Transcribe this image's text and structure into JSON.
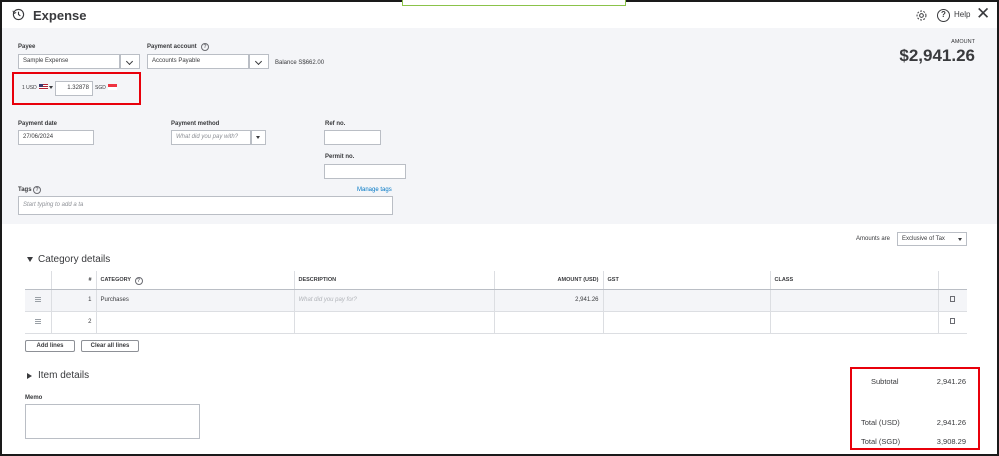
{
  "header": {
    "title": "Expense",
    "help_label": "Help",
    "close_glyph": "✕"
  },
  "payee": {
    "label": "Payee",
    "value": "Sample Expense"
  },
  "payment_account": {
    "label": "Payment account",
    "value": "Accounts Payable",
    "balance_text": "Balance S$662.00"
  },
  "exchange": {
    "from_currency": "1 USD",
    "rate": "1.32878",
    "to_currency": "SGD"
  },
  "amount": {
    "label": "AMOUNT",
    "value": "$2,941.26"
  },
  "payment_date": {
    "label": "Payment date",
    "value": "27/06/2024"
  },
  "payment_method": {
    "label": "Payment method",
    "placeholder": "What did you pay with?"
  },
  "ref_no": {
    "label": "Ref no.",
    "value": ""
  },
  "permit_no": {
    "label": "Permit no.",
    "value": ""
  },
  "tags": {
    "label": "Tags",
    "manage_link": "Manage tags",
    "placeholder": "Start typing to add a ta"
  },
  "amounts_are": {
    "label": "Amounts are",
    "value": "Exclusive of Tax"
  },
  "category_details": {
    "heading": "Category details",
    "columns": [
      "#",
      "CATEGORY",
      "DESCRIPTION",
      "AMOUNT (USD)",
      "GST",
      "CLASS"
    ],
    "rows": [
      {
        "num": "1",
        "category": "Purchases",
        "description": "What did you pay for?",
        "amount": "2,941.26",
        "gst": "",
        "class": ""
      },
      {
        "num": "2",
        "category": "",
        "description": "",
        "amount": "",
        "gst": "",
        "class": ""
      }
    ],
    "add_lines": "Add lines",
    "clear_all_lines": "Clear all lines"
  },
  "item_details": {
    "heading": "Item details"
  },
  "memo": {
    "label": "Memo",
    "value": ""
  },
  "totals": {
    "subtotal_label": "Subtotal",
    "subtotal_value": "2,941.26",
    "total_usd_label": "Total (USD)",
    "total_usd_value": "2,941.26",
    "total_sgd_label": "Total (SGD)",
    "total_sgd_value": "3,908.29"
  },
  "colors": {
    "highlight_red": "#e8000b",
    "link_blue": "#0077c5",
    "panel_gray": "#f4f5f8"
  }
}
